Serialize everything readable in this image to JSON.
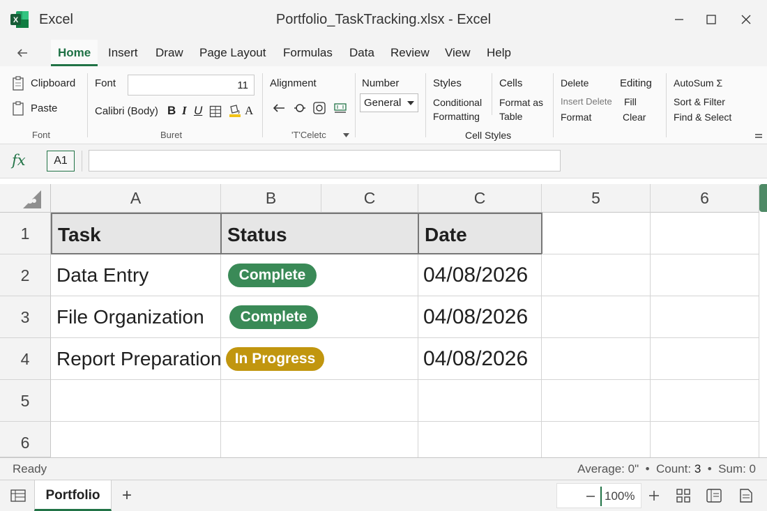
{
  "app": {
    "name": "Excel",
    "doc_title": "Portfolio_TaskTracking.xlsx - Excel"
  },
  "tabs": [
    {
      "label": "Home",
      "active": true
    },
    {
      "label": "Insert"
    },
    {
      "label": "Draw"
    },
    {
      "label": "Page Layout"
    },
    {
      "label": "Formulas"
    },
    {
      "label": "Data"
    },
    {
      "label": "Review"
    },
    {
      "label": "View"
    },
    {
      "label": "Help"
    }
  ],
  "ribbon": {
    "clipboard": "Clipboard",
    "paste": "Paste",
    "font_group_label": "Font",
    "font_label": "Font",
    "font_size": "11",
    "font_name": "Calibri (Body)",
    "bold": "B",
    "italic": "I",
    "underline": "U",
    "font_color": "A",
    "buret_label": "Buret",
    "alignment": "Alignment",
    "alignment_group_label": "'T'Celetc",
    "number": "Number",
    "number_format": "General",
    "styles": "Styles",
    "conditional_1": "Conditional",
    "conditional_2": "Formatting",
    "cells": "Cells",
    "format_as_1": "Format as",
    "format_as_2": "Table",
    "cell_styles": "Cell Styles",
    "delete": "Delete",
    "insert_delete": "Insert Delete",
    "format": "Format",
    "editing": "Editing",
    "fill": "Fill",
    "clear": "Clear",
    "autosum": "AutoSum Σ",
    "sort_filter": "Sort & Filter",
    "find_select": "Find & Select"
  },
  "formula_bar": {
    "fx": "fx",
    "name_box": "A1",
    "value": ""
  },
  "columns": [
    "A",
    "B",
    "C",
    "C",
    "5",
    "6"
  ],
  "rows": [
    "1",
    "2",
    "3",
    "4",
    "5",
    "6"
  ],
  "table": {
    "headers": [
      "Task",
      "Status",
      "Date"
    ],
    "rows": [
      {
        "task": "Data Entry",
        "status": "Complete",
        "date": "04/08/2026"
      },
      {
        "task": "File Organization",
        "status": "Complete",
        "date": "04/08/2026"
      },
      {
        "task": "Report Preparation",
        "status": "In Progress",
        "date": "04/08/2026"
      }
    ]
  },
  "status_colors": {
    "complete": "#3a8a57",
    "in_progress": "#c1960f"
  },
  "accent": "#217346",
  "status_bar": {
    "ready": "Ready",
    "average": "Average: 0\"",
    "count_label": "Count:",
    "count": "3",
    "sum": "Sum: 0",
    "sep": "•"
  },
  "sheet_bar": {
    "sheet": "Portfolio",
    "add": "+",
    "zoom": "100%"
  },
  "icons": [
    "excel-logo",
    "back-arrow-icon",
    "clipboard-icon",
    "paste-icon",
    "border-icon",
    "fill-color-icon",
    "align-left-icon",
    "align-center-icon",
    "wrap-icon",
    "merge-icon",
    "search-icon",
    "zoom-out-icon",
    "zoom-in-icon",
    "normal-view-icon",
    "page-layout-icon",
    "page-break-icon"
  ]
}
